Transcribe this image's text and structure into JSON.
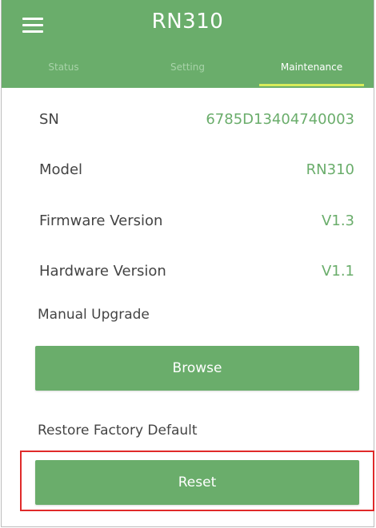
{
  "header": {
    "title": "RN310",
    "menu_icon": "hamburger-menu-icon",
    "background_color": "#6aad6b",
    "tab_underline_color": "#d8ec5a"
  },
  "tabs": [
    {
      "label": "Status",
      "active": false
    },
    {
      "label": "Setting",
      "active": false
    },
    {
      "label": "Maintenance",
      "active": true
    }
  ],
  "info": {
    "sn": {
      "label": "SN",
      "value": "6785D13404740003"
    },
    "model": {
      "label": "Model",
      "value": "RN310"
    },
    "firmware": {
      "label": "Firmware Version",
      "value": "V1.3"
    },
    "hardware": {
      "label": "Hardware Version",
      "value": "V1.1"
    }
  },
  "upgrade": {
    "label": "Manual Upgrade",
    "button_label": "Browse"
  },
  "restore": {
    "label": "Restore Factory Default",
    "button_label": "Reset",
    "highlight_color": "#e02a2a"
  }
}
